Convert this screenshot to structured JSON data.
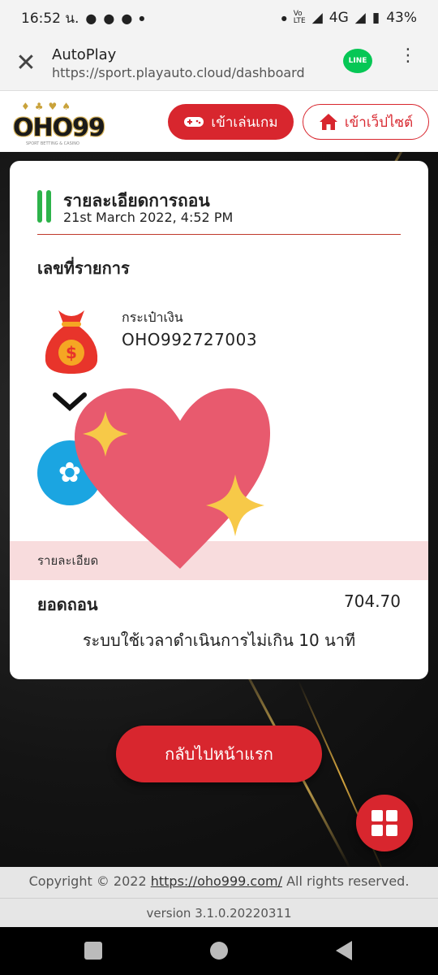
{
  "status_bar": {
    "time": "16:52 น.",
    "network": "4G",
    "battery": "43%"
  },
  "browser": {
    "title": "AutoPlay",
    "url": "https://sport.playauto.cloud/dashboard",
    "line_badge": "LINE"
  },
  "header": {
    "logo_text": "OHO99",
    "logo_sub": "SPORT BETTING & CASINO",
    "play_button": "เข้าเล่นเกม",
    "website_button": "เข้าเว็ปไซต์"
  },
  "card": {
    "title": "รายละเอียดการถอน",
    "date": "21st March 2022, 4:52 PM",
    "section_title": "เลขที่รายการ",
    "wallet_label": "กระเป๋าเงิน",
    "wallet_id": "OHO992727003",
    "detail_label": "รายละเอียด",
    "amount_label": "ยอดถอน",
    "amount_value": "704.70",
    "note": "ระบบใช้เวลาดำเนินการไม่เกิน 10 นาที"
  },
  "home_button": "กลับไปหน้าแรก",
  "footer": {
    "copyright_prefix": "Copyright © 2022",
    "copyright_link": "https://oho999.com/",
    "copyright_suffix": "All rights reserved.",
    "version": "version 3.1.0.20220311"
  },
  "colors": {
    "accent": "#d8262e",
    "green_bar": "#2db34a",
    "detail_bg": "#f8dcdd",
    "bank": "#1ba5e1",
    "heart": "#e85a6e",
    "sparkle": "#f7c948"
  }
}
